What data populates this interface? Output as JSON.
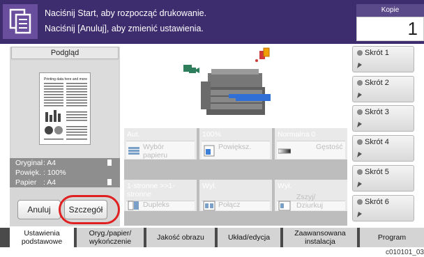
{
  "header": {
    "line1": "Naciśnij Start, aby rozpocząć drukowanie.",
    "line2": "Naciśnij [Anuluj], aby zmienić ustawienia.",
    "copies_label": "Kopie",
    "copies_value": "1",
    "icon": "copy-icon"
  },
  "preview": {
    "label": "Podgląd",
    "page_text": "Printing data here and more",
    "info": [
      {
        "label": "Oryginał",
        "value": "A4"
      },
      {
        "label": "Powięk.",
        "value": "100%"
      },
      {
        "label": "Papier",
        "value": "A4"
      }
    ],
    "cancel_label": "Anuluj",
    "detail_label": "Szczegół"
  },
  "functions": [
    {
      "value": "Aut.",
      "label": "Wybór papieru",
      "icon": "paper-select-icon"
    },
    {
      "value": "100%",
      "label": "Powiększ.",
      "icon": "zoom-icon"
    },
    {
      "value": "Normalna 0",
      "label": "Gęstość",
      "icon": "density-icon"
    },
    {
      "value": "1-stronne >>1-stronne",
      "label": "Dupleks",
      "icon": "duplex-icon"
    },
    {
      "value": "Wył.",
      "label": "Połącz",
      "icon": "combine-icon"
    },
    {
      "value": "Wył.",
      "label": "Zszyj/ Dziurkuj",
      "icon": "staple-icon"
    }
  ],
  "shortcuts": [
    {
      "label": "Skrót 1"
    },
    {
      "label": "Skrót 2"
    },
    {
      "label": "Skrót 3"
    },
    {
      "label": "Skrót 4"
    },
    {
      "label": "Skrót 5"
    },
    {
      "label": "Skrót 6"
    }
  ],
  "tabs": [
    {
      "label": "Ustawienia podstawowe",
      "active": true
    },
    {
      "label": "Oryg./papier/ wykończenie"
    },
    {
      "label": "Jakość obrazu"
    },
    {
      "label": "Układ/edycja"
    },
    {
      "label": "Zaawansowana instalacja"
    },
    {
      "label": "Program"
    }
  ],
  "footer_code": "c010101_03",
  "colors": {
    "header_bg": "#3d2c6e",
    "highlight_oval": "#e02020"
  }
}
